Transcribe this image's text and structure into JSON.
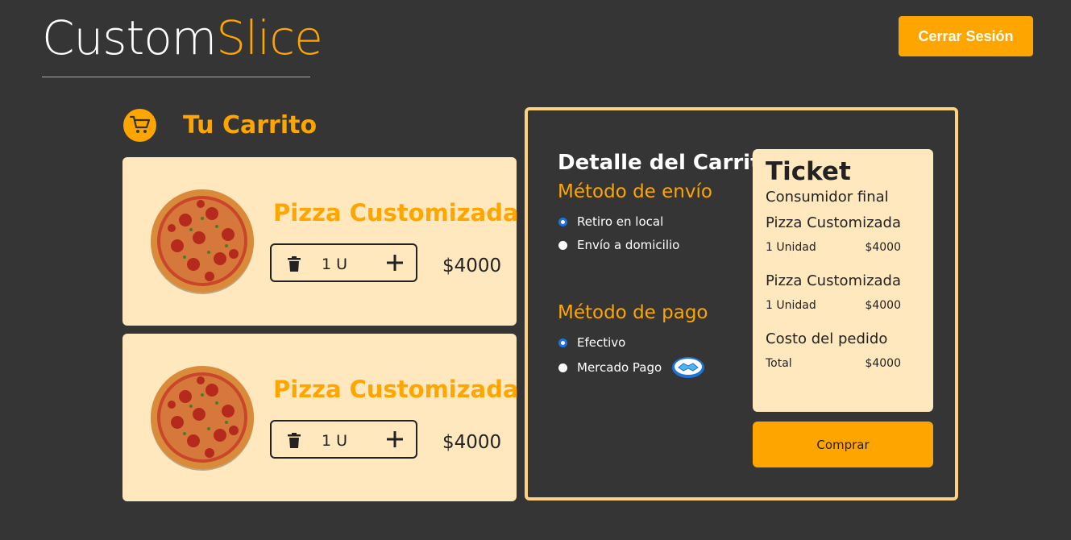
{
  "header": {
    "logo_part1": "Custom",
    "logo_part2": "Slice",
    "logout_label": "Cerrar Sesión"
  },
  "cart": {
    "title": "Tu Carrito",
    "items": [
      {
        "name": "Pizza Customizada",
        "quantity": "1 U",
        "price": "$4000"
      },
      {
        "name": "Pizza Customizada",
        "quantity": "1 U",
        "price": "$4000"
      }
    ]
  },
  "detail": {
    "title": "Detalle del Carrito",
    "shipping": {
      "label": "Método de envío",
      "options": [
        "Retiro en local",
        "Envío a domicilio"
      ],
      "selected": "Retiro en local"
    },
    "payment": {
      "label": "Método de pago",
      "options": [
        "Efectivo",
        "Mercado Pago"
      ],
      "selected": "Efectivo"
    }
  },
  "ticket": {
    "title": "Ticket",
    "consumer": "Consumidor final",
    "lines": [
      {
        "name": "Pizza Customizada",
        "units": "1 Unidad",
        "price": "$4000"
      },
      {
        "name": "Pizza Customizada",
        "units": "1 Unidad",
        "price": "$4000"
      }
    ],
    "cost_label": "Costo del pedido",
    "total_label": "Total",
    "total_value": "$4000"
  },
  "buy_label": "Comprar",
  "colors": {
    "background": "#353535",
    "accent": "#FFA500",
    "card": "#FFE8BD",
    "panel_border": "#FFD27F"
  },
  "icons": {
    "cart": "cart-icon",
    "trash": "trash-icon",
    "plus": "plus-icon",
    "mercadopago": "handshake-icon"
  }
}
